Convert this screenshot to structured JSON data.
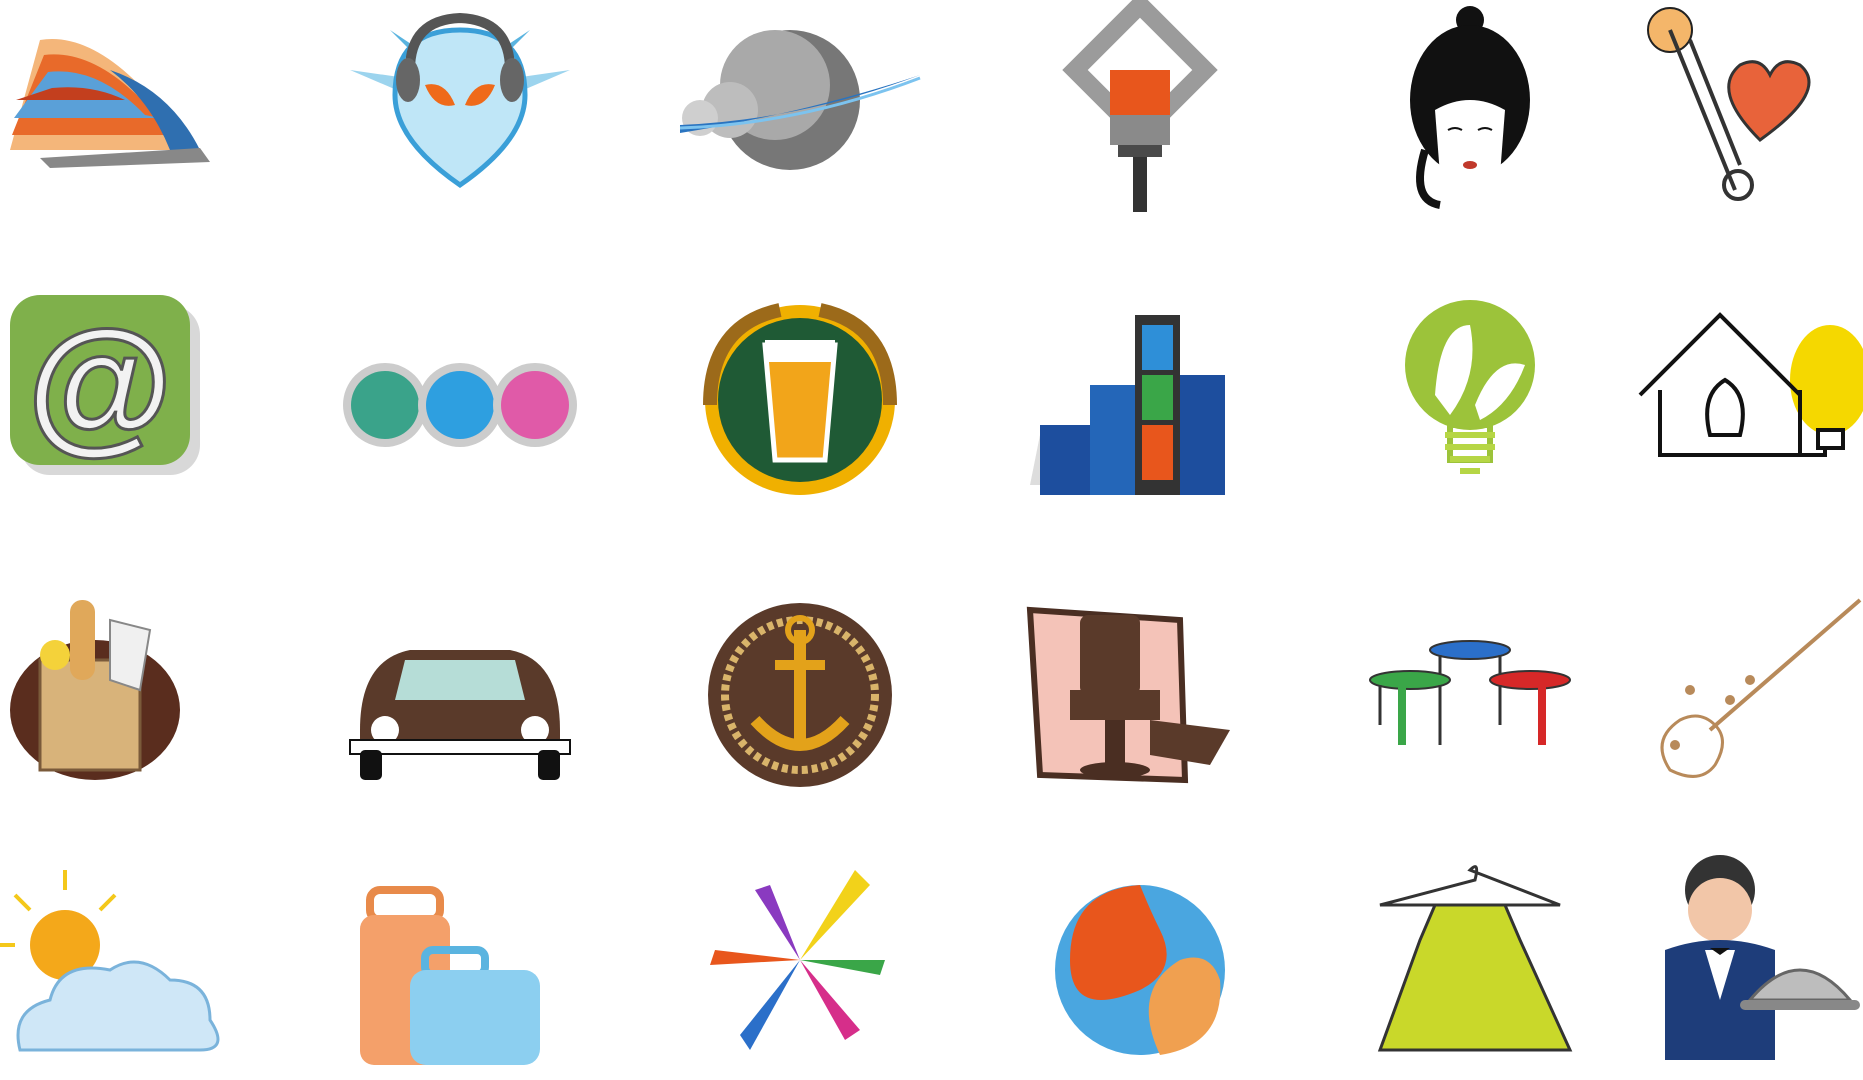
{
  "sheet": {
    "rows": [
      [
        "sailboat-stripes-icon",
        "alien-headphones-icon",
        "saturn-planet-icon",
        "paint-brush-house-icon",
        "woman-bun-face-icon",
        "safety-pin-heart-icon"
      ],
      [
        "at-sign-3d-icon",
        "three-colored-circles-icon",
        "beer-glass-wreath-icon",
        "city-film-strip-icon",
        "leaf-lightbulb-icon",
        "house-lightbulb-plug-icon"
      ],
      [
        "grocery-bag-icon",
        "vintage-beetle-car-icon",
        "anchor-rope-badge-icon",
        "barber-chair-icon",
        "colored-tables-icon",
        "guitar-music-notes-icon"
      ],
      [
        "sun-cloud-icon",
        "luggage-bags-icon",
        "colorful-star-burst-icon",
        "swirl-sphere-icon",
        "dress-hanger-icon",
        "waiter-cloche-icon"
      ]
    ]
  },
  "colors": {
    "orange": "#e8561c",
    "blue": "#2f8ad0",
    "green": "#7cb342",
    "brown": "#5a3a2a",
    "gold": "#e3a21a",
    "black": "#111111"
  }
}
